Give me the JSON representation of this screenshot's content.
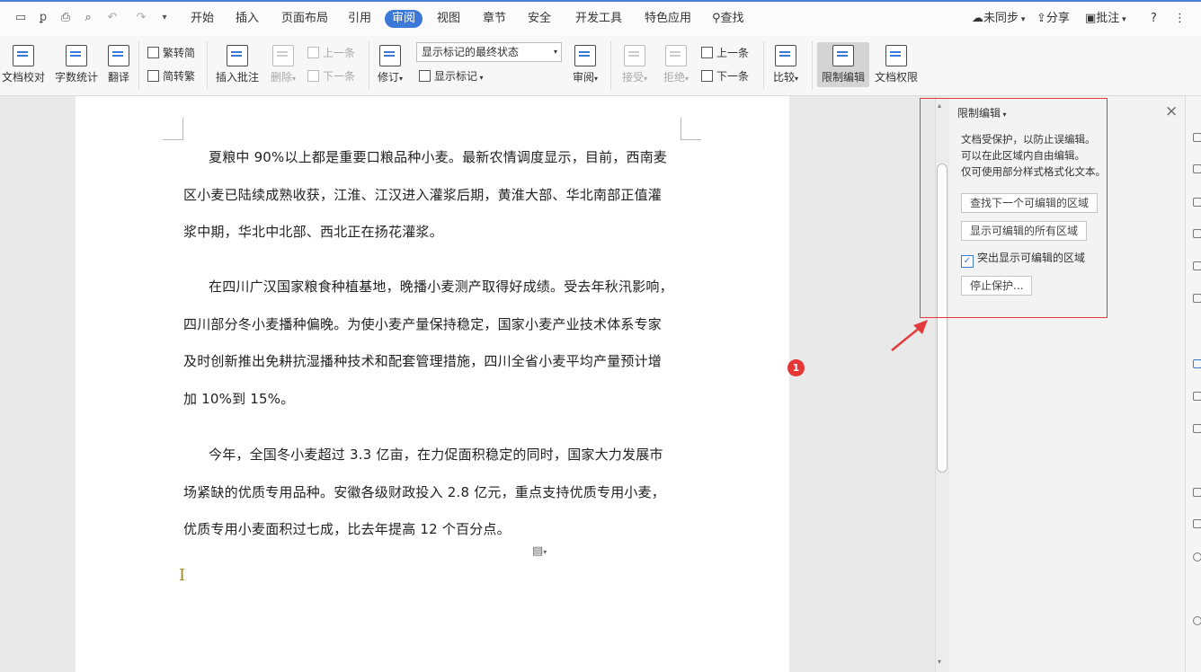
{
  "menubar": {
    "tabs": [
      "开始",
      "插入",
      "页面布局",
      "引用",
      "审阅",
      "视图",
      "章节",
      "安全",
      "开发工具",
      "特色应用"
    ],
    "active_tab": "审阅",
    "search_label": "查找",
    "sync_label": "未同步",
    "share_label": "分享",
    "comment_label": "批注",
    "help_label": "?",
    "more_label": "⋮"
  },
  "ribbon": {
    "proofread": "文档校对",
    "wordcount": "字数统计",
    "translate": "翻译",
    "trad_to_simp": "繁转简",
    "simp_to_trad": "简转繁",
    "insert_comment": "插入批注",
    "delete": "删除",
    "prev_comment": "上一条",
    "next_comment": "下一条",
    "revise": "修订",
    "display_state": "显示标记的最终状态",
    "show_marks": "显示标记",
    "review": "审阅",
    "accept": "接受",
    "reject": "拒绝",
    "prev_change": "上一条",
    "next_change": "下一条",
    "compare": "比较",
    "restrict_edit": "限制编辑",
    "doc_permission": "文档权限"
  },
  "document": {
    "paragraphs": [
      [
        "夏粮中 90%以上都是重要口粮品种小麦。最新农情调度显示，目前，西南麦",
        "区小麦已陆续成熟收获，江淮、江汉进入灌浆后期，黄淮大部、华北南部正值灌",
        "浆中期，华北中北部、西北正在扬花灌浆。"
      ],
      [
        "在四川广汉国家粮食种植基地，晚播小麦测产取得好成绩。受去年秋汛影响，",
        "四川部分冬小麦播种偏晚。为使小麦产量保持稳定，国家小麦产业技术体系专家",
        "及时创新推出免耕抗湿播种技术和配套管理措施，四川全省小麦平均产量预计增",
        "加 10%到 15%。"
      ],
      [
        "今年，全国冬小麦超过 3.3 亿亩，在力促面积稳定的同时，国家大力发展市",
        "场紧缺的优质专用品种。安徽各级财政投入 2.8 亿元，重点支持优质专用小麦，",
        "优质专用小麦面积过七成，比去年提高 12 个百分点。"
      ]
    ],
    "badge": "1"
  },
  "panel": {
    "title": "限制编辑",
    "desc": [
      "文档受保护，以防止误编辑。",
      "可以在此区域内自由编辑。",
      "仅可使用部分样式格式化文本。"
    ],
    "find_next": "查找下一个可编辑的区域",
    "show_all": "显示可编辑的所有区域",
    "highlight_label": "突出显示可编辑的区域",
    "highlight_checked": true,
    "stop_protect": "停止保护...",
    "close": "×"
  },
  "colors": {
    "accent": "#3b78d8",
    "annotation": "#e33b3b"
  }
}
